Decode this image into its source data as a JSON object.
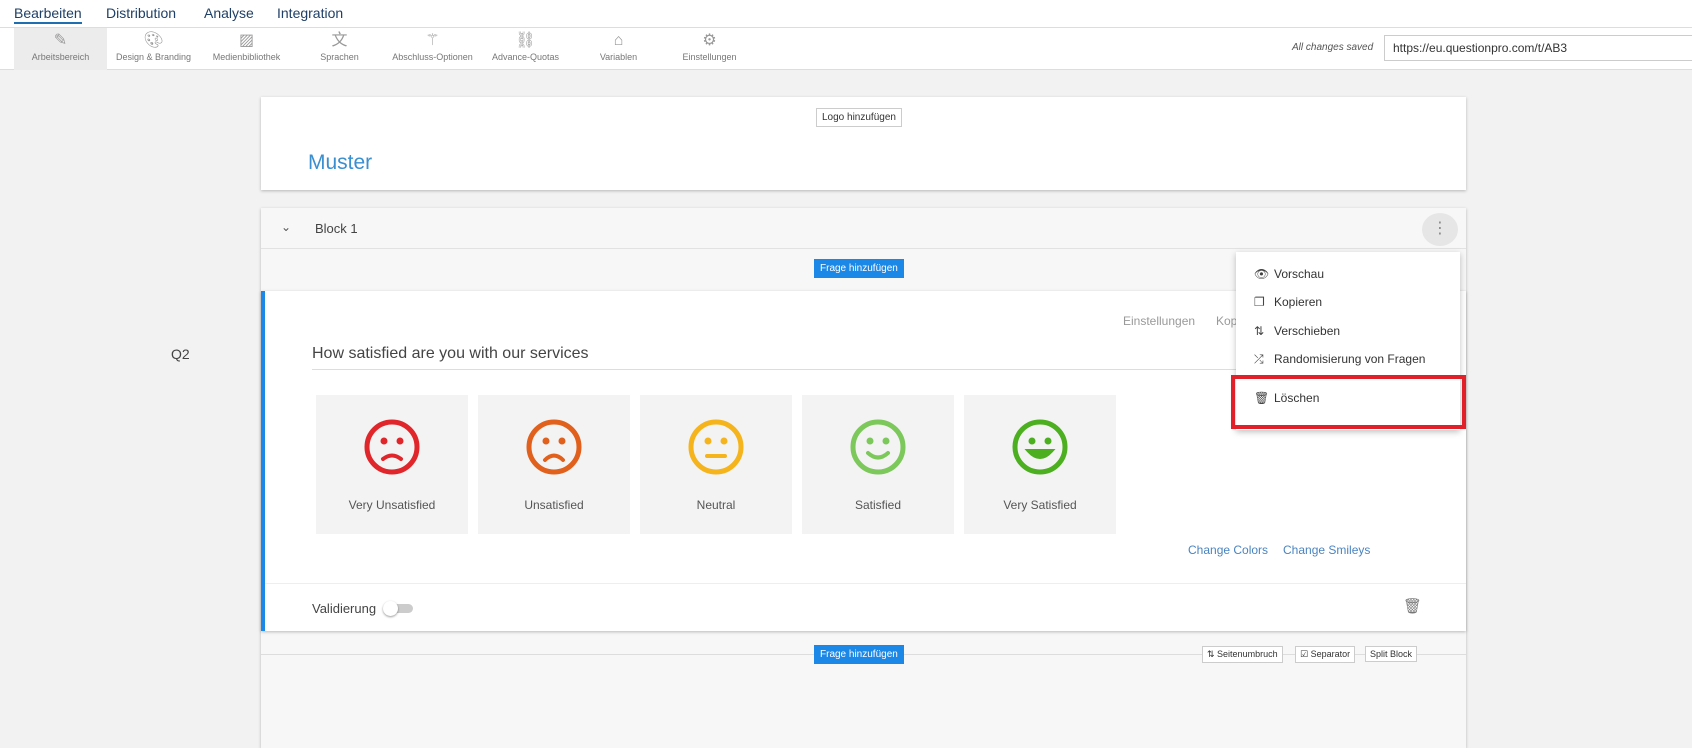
{
  "topnav": [
    "Bearbeiten",
    "Distribution",
    "Analyse",
    "Integration"
  ],
  "toolbar": {
    "items": [
      "Arbeitsbereich",
      "Design & Branding",
      "Medienbibliothek",
      "Sprachen",
      "Abschluss-Optionen",
      "Advance-Quotas",
      "Variablen",
      "Einstellungen"
    ],
    "saved": "All changes saved",
    "url": "https://eu.questionpro.com/t/AB3"
  },
  "header": {
    "logo_button": "Logo hinzufügen",
    "title": "Muster"
  },
  "block": {
    "title": "Block 1",
    "add_question": "Frage hinzufügen"
  },
  "question": {
    "number": "Q2",
    "text": "How satisfied are you with our services",
    "actions": [
      "Einstellungen",
      "Kop"
    ],
    "options": [
      {
        "label": "Very Unsatisfied",
        "color": "#e0262a"
      },
      {
        "label": "Unsatisfied",
        "color": "#e0601c"
      },
      {
        "label": "Neutral",
        "color": "#f5b41c"
      },
      {
        "label": "Satisfied",
        "color": "#7cc85a"
      },
      {
        "label": "Very Satisfied",
        "color": "#4caf1f"
      }
    ],
    "change_colors": "Change Colors",
    "change_smileys": "Change Smileys",
    "validation": "Validierung"
  },
  "menu": {
    "items": [
      "Vorschau",
      "Kopieren",
      "Verschieben",
      "Randomisierung von Fragen",
      "Löschen"
    ]
  },
  "footer": {
    "add_question": "Frage hinzufügen",
    "page_break": "Seitenumbruch",
    "separator": "Separator",
    "split": "Split Block"
  }
}
